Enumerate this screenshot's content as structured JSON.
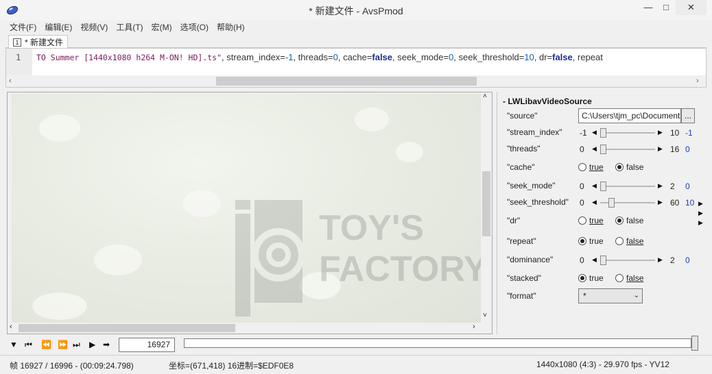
{
  "window": {
    "title": "* 新建文件 - AvsPmod",
    "min_icon": "minimize-icon",
    "max_icon": "maximize-icon",
    "close_icon": "close-icon"
  },
  "menu": [
    "文件(F)",
    "编辑(E)",
    "视频(V)",
    "工具(T)",
    "宏(M)",
    "选项(O)",
    "帮助(H)"
  ],
  "tab": {
    "number": "1",
    "label": "* 新建文件"
  },
  "editor": {
    "line_number": "1",
    "tokens": [
      {
        "t": "TO Summer [1440x1080 h264 M-ON! HD].ts\"",
        "c": "str"
      },
      {
        "t": ", stream_index=",
        "c": "plain"
      },
      {
        "t": "-1",
        "c": "num"
      },
      {
        "t": ", threads=",
        "c": "plain"
      },
      {
        "t": "0",
        "c": "num"
      },
      {
        "t": ", cache=",
        "c": "plain"
      },
      {
        "t": "false",
        "c": "kw"
      },
      {
        "t": ", seek_mode=",
        "c": "plain"
      },
      {
        "t": "0",
        "c": "num"
      },
      {
        "t": ", seek_threshold=",
        "c": "plain"
      },
      {
        "t": "10",
        "c": "num"
      },
      {
        "t": ", dr=",
        "c": "plain"
      },
      {
        "t": "false",
        "c": "kw"
      },
      {
        "t": ", repeat",
        "c": "plain"
      }
    ]
  },
  "video": {
    "watermark_line1": "TOY'S",
    "watermark_line2": "FACTORY"
  },
  "props": {
    "header": "- LWLibavVideoSource",
    "source": {
      "label": "\"source\"",
      "value": "C:\\Users\\tjm_pc\\Documents",
      "browse": "..."
    },
    "sliders": [
      {
        "key": "stream_index",
        "label": "\"stream_index\"",
        "min": "-1",
        "max": "10",
        "value": "-1",
        "pos": 0.0
      },
      {
        "key": "threads",
        "label": "\"threads\"",
        "min": "0",
        "max": "16",
        "value": "0",
        "pos": 0.0
      },
      {
        "key": "seek_mode",
        "label": "\"seek_mode\"",
        "min": "0",
        "max": "2",
        "value": "0",
        "pos": 0.0
      },
      {
        "key": "seek_threshold",
        "label": "\"seek_threshold\"",
        "min": "0",
        "max": "60",
        "value": "10",
        "pos": 0.1667
      },
      {
        "key": "dominance",
        "label": "\"dominance\"",
        "min": "0",
        "max": "2",
        "value": "0",
        "pos": 0.0
      }
    ],
    "radios": [
      {
        "key": "cache",
        "label": "\"cache\"",
        "true": "true",
        "false": "false",
        "selected": "false"
      },
      {
        "key": "dr",
        "label": "\"dr\"",
        "true": "true",
        "false": "false",
        "selected": "false"
      },
      {
        "key": "repeat",
        "label": "\"repeat\"",
        "true": "true",
        "false": "false",
        "selected": "true"
      },
      {
        "key": "stacked",
        "label": "\"stacked\"",
        "true": "true",
        "false": "false",
        "selected": "true"
      }
    ],
    "format": {
      "label": "\"format\"",
      "value": "*"
    }
  },
  "playback": {
    "frame": "16927"
  },
  "status": {
    "frame_info": "帧 16927 / 16996  -  (00:09:24.798)",
    "coords": "坐标=(671,418)  16进制=$EDF0E8",
    "video_info": "1440x1080 (4:3)  -  29.970 fps  -  YV12"
  }
}
